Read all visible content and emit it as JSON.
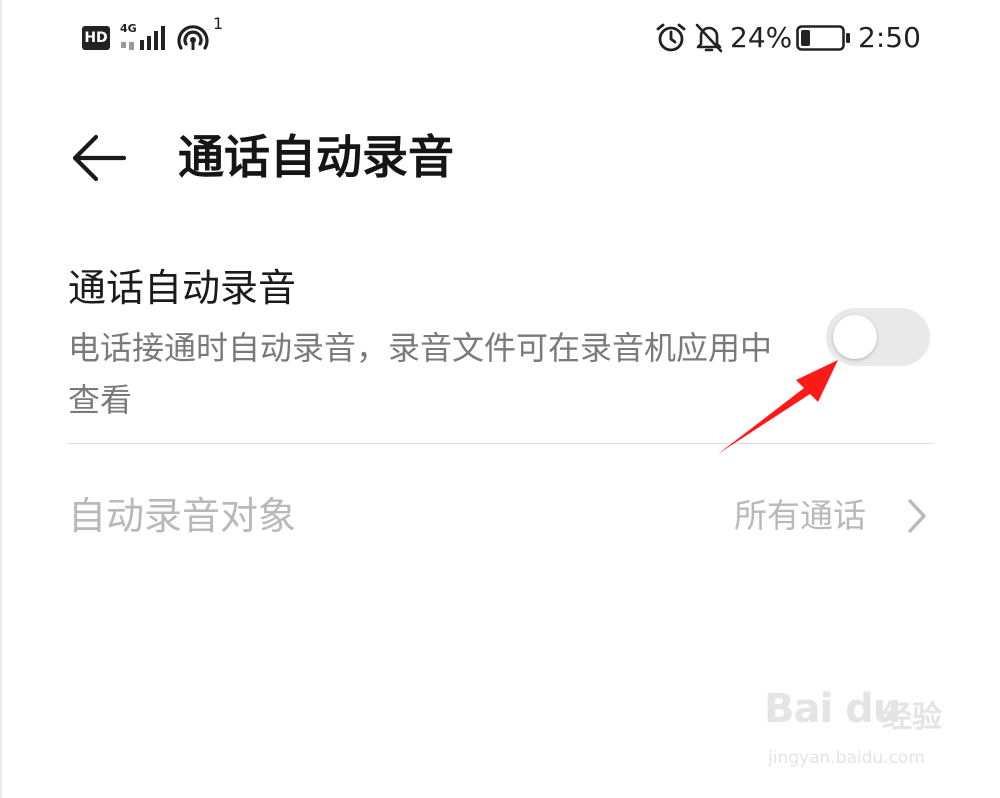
{
  "status_bar": {
    "hd": "HD",
    "network_type": "4G",
    "hotspot_count": "1",
    "battery_percent": "24%",
    "battery_level": 0.24,
    "time": "2:50",
    "icons": [
      "signal-icon",
      "hotspot-icon",
      "alarm-icon",
      "bell-off-icon",
      "battery-icon"
    ]
  },
  "header": {
    "back_icon": "arrow-left-icon",
    "title": "通话自动录音"
  },
  "auto_record": {
    "title": "通话自动录音",
    "description": "电话接通时自动录音，录音文件可在录音机应用中查看",
    "enabled": false
  },
  "record_target": {
    "label": "自动录音对象",
    "value": "所有通话",
    "icon": "chevron-right-icon"
  },
  "watermark": {
    "brand": "Bai du",
    "product": "经验",
    "url": "jingyan.baidu.com"
  },
  "colors": {
    "annotation_arrow": "#ff1a1a",
    "toggle_off_track": "#e9e9e9",
    "disabled_text": "#b9b9b9",
    "secondary_text": "#7a7a7a"
  }
}
